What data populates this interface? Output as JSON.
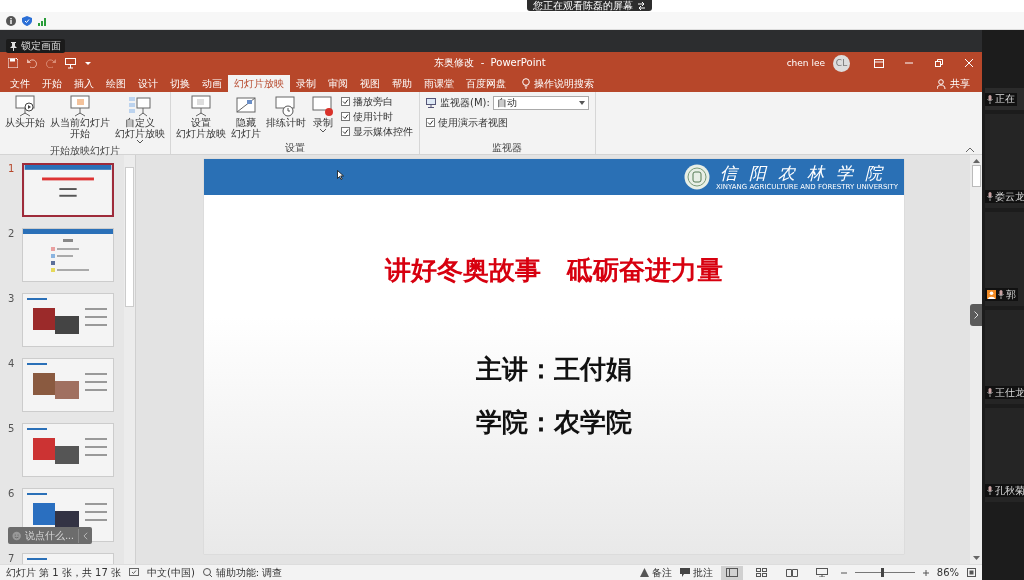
{
  "share_banner": {
    "text": "您正在观看陈磊的屏幕"
  },
  "lock_tooltip": {
    "text": "锁定画面"
  },
  "window": {
    "title": "东奥修改  -  PowerPoint",
    "user": "chen lee",
    "avatar": "CL"
  },
  "tabs": [
    {
      "label": "文件",
      "selected": false
    },
    {
      "label": "开始",
      "selected": false
    },
    {
      "label": "插入",
      "selected": false
    },
    {
      "label": "绘图",
      "selected": false
    },
    {
      "label": "设计",
      "selected": false
    },
    {
      "label": "切换",
      "selected": false
    },
    {
      "label": "动画",
      "selected": false
    },
    {
      "label": "幻灯片放映",
      "selected": true
    },
    {
      "label": "录制",
      "selected": false
    },
    {
      "label": "审阅",
      "selected": false
    },
    {
      "label": "视图",
      "selected": false
    },
    {
      "label": "帮助",
      "selected": false
    },
    {
      "label": "雨课堂",
      "selected": false
    },
    {
      "label": "百度网盘",
      "selected": false
    }
  ],
  "search_hint": "操作说明搜索",
  "share_button": "共享",
  "ribbon_groups": [
    {
      "label": "开始放映幻灯片",
      "items": [
        {
          "kind": "large",
          "lines": [
            "从头开始"
          ],
          "dropdown": false
        },
        {
          "kind": "large",
          "lines": [
            "从当前幻灯片",
            "开始"
          ],
          "dropdown": false
        },
        {
          "kind": "large",
          "lines": [
            "自定义",
            "幻灯片放映"
          ],
          "dropdown": true
        }
      ]
    },
    {
      "label": "设置",
      "items": [
        {
          "kind": "large",
          "lines": [
            "设置",
            "幻灯片放映"
          ],
          "dropdown": false
        },
        {
          "kind": "large",
          "lines": [
            "隐藏",
            "幻灯片"
          ],
          "dropdown": false
        },
        {
          "kind": "large",
          "lines": [
            "排练计时"
          ],
          "dropdown": false
        },
        {
          "kind": "large",
          "lines": [
            "录制"
          ],
          "dropdown": true
        },
        {
          "kind": "check",
          "label": "播放旁白",
          "checked": true
        },
        {
          "kind": "check",
          "label": "使用计时",
          "checked": true
        },
        {
          "kind": "check",
          "label": "显示媒体控件",
          "checked": true
        }
      ]
    },
    {
      "label": "监视器",
      "items": [
        {
          "kind": "select",
          "label": "监视器(M):",
          "value": "自动"
        },
        {
          "kind": "check",
          "label": "使用演示者视图",
          "checked": true
        }
      ]
    }
  ],
  "thumbnails": [
    {
      "number": "1",
      "selected": true
    },
    {
      "number": "2",
      "selected": false
    },
    {
      "number": "3",
      "selected": false
    },
    {
      "number": "4",
      "selected": false
    },
    {
      "number": "5",
      "selected": false
    },
    {
      "number": "6",
      "selected": false
    },
    {
      "number": "7",
      "selected": false
    }
  ],
  "slide": {
    "school": "信阳农林学院",
    "school_en": "XINYANG AGRICULTURE AND FORESTRY UNIVERSITY",
    "title": "讲好冬奥故事　砥砺奋进力量",
    "lines": [
      "主讲：王付娟",
      "学院：农学院"
    ]
  },
  "status_bar": {
    "slide_info": "幻灯片 第 1 张，共 17 张",
    "language": "中文(中国)",
    "accessibility": "辅助功能: 调查",
    "notes": "备注",
    "comments": "批注",
    "views": [
      {
        "selected": true
      },
      {
        "selected": false
      },
      {
        "selected": false
      },
      {
        "selected": false
      }
    ],
    "zoom_slider": {
      "level": 0.45
    },
    "zoom": "86%"
  },
  "chat_box": {
    "placeholder": "说点什么..."
  },
  "participants": [
    {
      "name": "正在",
      "avatar": false
    },
    {
      "name": "娄云龙",
      "avatar": false
    },
    {
      "name": "郭",
      "avatar": true
    },
    {
      "name": "王仕龙",
      "avatar": false
    },
    {
      "name": "孔秋菊",
      "avatar": false
    }
  ]
}
